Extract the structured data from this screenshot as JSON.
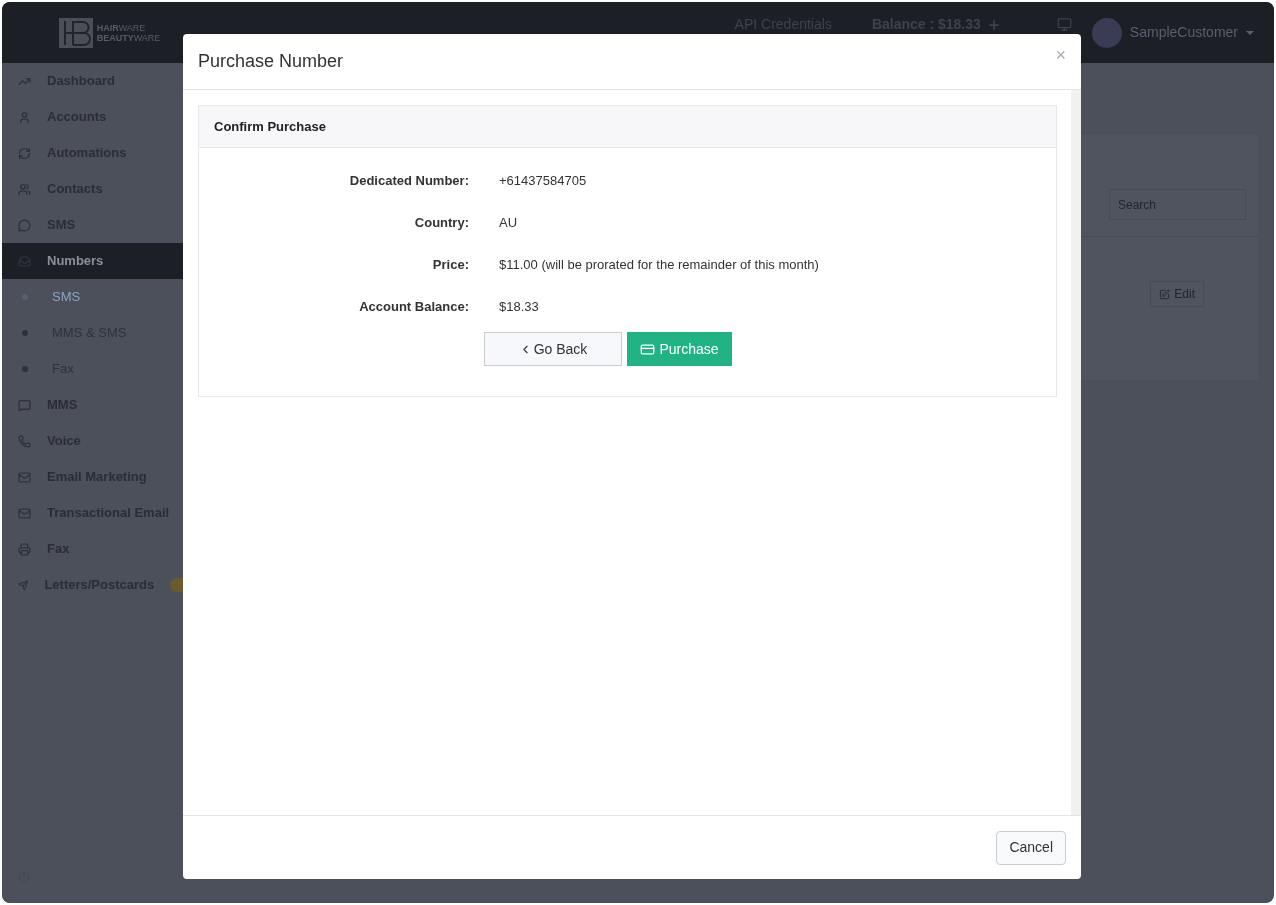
{
  "header": {
    "logo_lines": [
      "**HAIR**WARE",
      "**BEAUTY**WARE"
    ],
    "links": [
      "API Credentials"
    ],
    "balance": "Balance : $18.33",
    "user": "SampleCustomer"
  },
  "sidebar": {
    "items": [
      {
        "label": "Dashboard",
        "selected": false
      },
      {
        "label": "Accounts",
        "selected": false
      },
      {
        "label": "Automations",
        "selected": false
      },
      {
        "label": "Contacts",
        "selected": false
      },
      {
        "label": "SMS",
        "selected": false
      },
      {
        "label": "Numbers",
        "selected": true,
        "children": [
          {
            "label": "SMS",
            "selected": true
          },
          {
            "label": "MMS & SMS",
            "selected": false
          },
          {
            "label": "Fax",
            "selected": false
          }
        ]
      },
      {
        "label": "MMS",
        "selected": false
      },
      {
        "label": "Voice",
        "selected": false
      },
      {
        "label": "Email Marketing",
        "selected": false
      },
      {
        "label": "Transactional Email",
        "selected": false
      },
      {
        "label": "Fax",
        "selected": false
      },
      {
        "label": "Letters/Postcards",
        "selected": false,
        "badge": true
      }
    ]
  },
  "background": {
    "search": {
      "placeholder": "Search"
    },
    "edit_button": "Edit"
  },
  "modal": {
    "title": "Purchase Number",
    "close": "×",
    "panel": {
      "title": "Confirm Purchase",
      "fields": [
        {
          "label": "Dedicated Number:",
          "value": "+61437584705"
        },
        {
          "label": "Country:",
          "value": "AU"
        },
        {
          "label": "Price:",
          "value": "$11.00 (will be prorated for the remainder of this month)"
        },
        {
          "label": "Account Balance:",
          "value": "$18.33"
        }
      ],
      "back_button": "Go Back",
      "purchase_button": "Purchase"
    },
    "footer_button": "Cancel"
  }
}
